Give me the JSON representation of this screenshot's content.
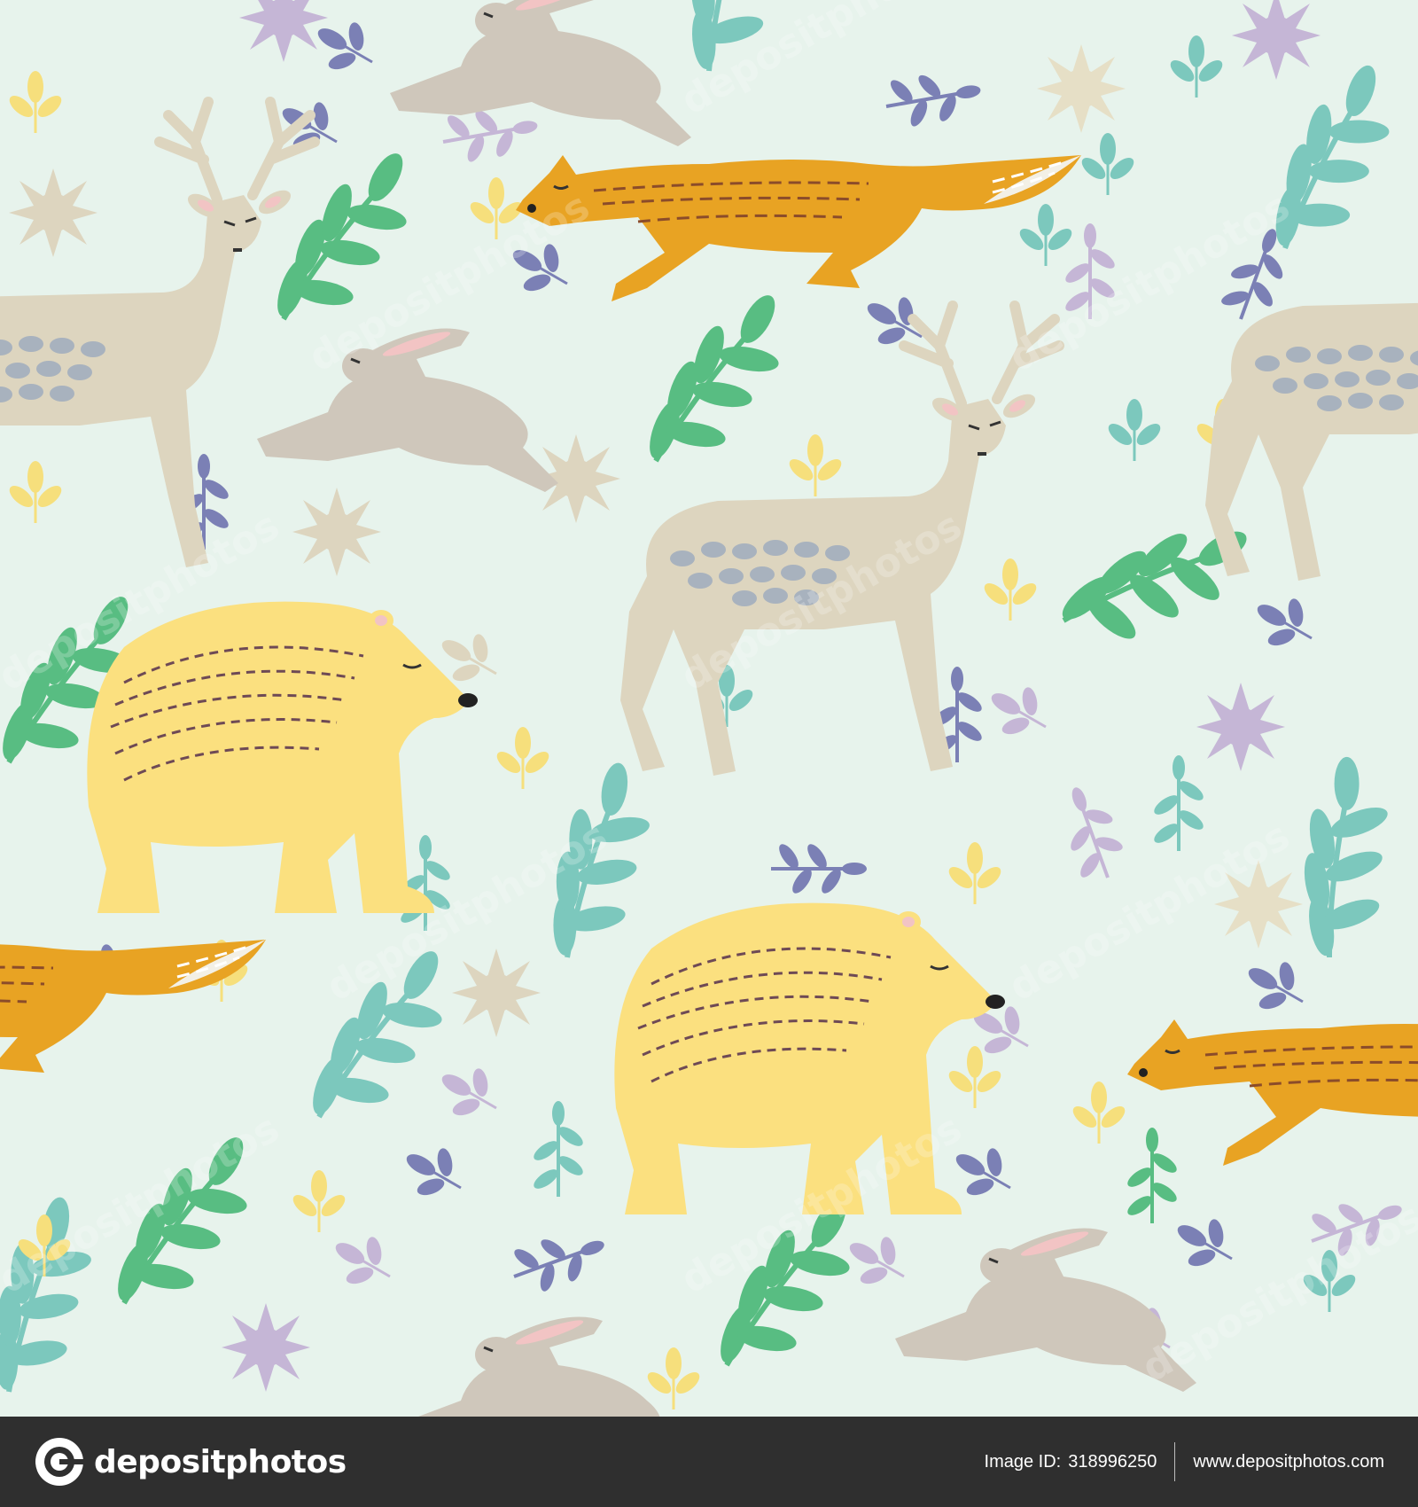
{
  "image": {
    "subject": "seamless woodland pattern with deer, foxes, bears, hares and leaves",
    "colors": {
      "background": "#e7f3ec",
      "fox": "#e8a323",
      "bear": "#fbe07f",
      "deer": "#ddd5bf",
      "hare": "#cfc7bb",
      "leaf_green": "#58bd82",
      "leaf_teal": "#7cc8bd",
      "leaf_purple": "#7b80b5",
      "leaf_lilac": "#c5b6d6",
      "leaf_yellow": "#f6df7c",
      "footer": "#2f2f2f"
    },
    "watermark_text": "depositphotos"
  },
  "footer": {
    "brand": "depositphotos",
    "image_id_label": "Image ID:",
    "image_id": "318996250",
    "site": "www.depositphotos.com"
  }
}
